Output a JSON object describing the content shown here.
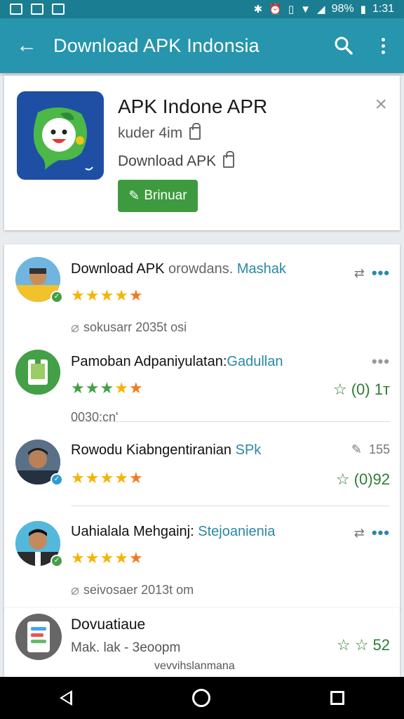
{
  "status_bar": {
    "battery": "98%",
    "time": "1:31"
  },
  "app_bar": {
    "title": "Download APK Indonsia"
  },
  "hero": {
    "title": "APK Indone APR",
    "subtitle": "kuder 4im",
    "subtitle2": "Download APK",
    "install_label": "Brinuar"
  },
  "list": {
    "items": [
      {
        "title_main": "Download APK",
        "title_muted": "orowdans.",
        "title_pub": "Mashak",
        "stars": [
          "y",
          "y",
          "y",
          "y",
          "o"
        ],
        "meta": "sokusarr 2035t osi",
        "actions": "more-blue"
      },
      {
        "title_main": "Pamoban Adpaniyulatan:",
        "title_pub": "Gadullan",
        "stars": [
          "g",
          "g",
          "g",
          "y",
          "o"
        ],
        "rating": "(0) 1т",
        "meta": "0030:cn'",
        "actions": "more-gray"
      },
      {
        "title_main": "Rowodu Kiabngentiranian",
        "title_pub": "SPk",
        "stars": [
          "y",
          "y",
          "y",
          "y",
          "o"
        ],
        "rating": "(0)92",
        "side_count": "155"
      },
      {
        "title_main": "Uahialala Mehgainj:",
        "title_pub": "Stejoanienia",
        "stars": [
          "y",
          "y",
          "y",
          "y",
          "o"
        ],
        "meta": "seivosaer 2013t om",
        "actions": "more-blue"
      }
    ]
  },
  "bottom_item": {
    "title": "Dovuatiaue",
    "subtitle": "Mak. lak - 3eoopm",
    "footer": "vevvihslanmana",
    "rating": "52"
  },
  "colors": {
    "appbar": "#2695ad",
    "statusbar": "#1a7d92",
    "accent_green": "#3e9a3e",
    "publisher_link": "#2a88a8"
  }
}
